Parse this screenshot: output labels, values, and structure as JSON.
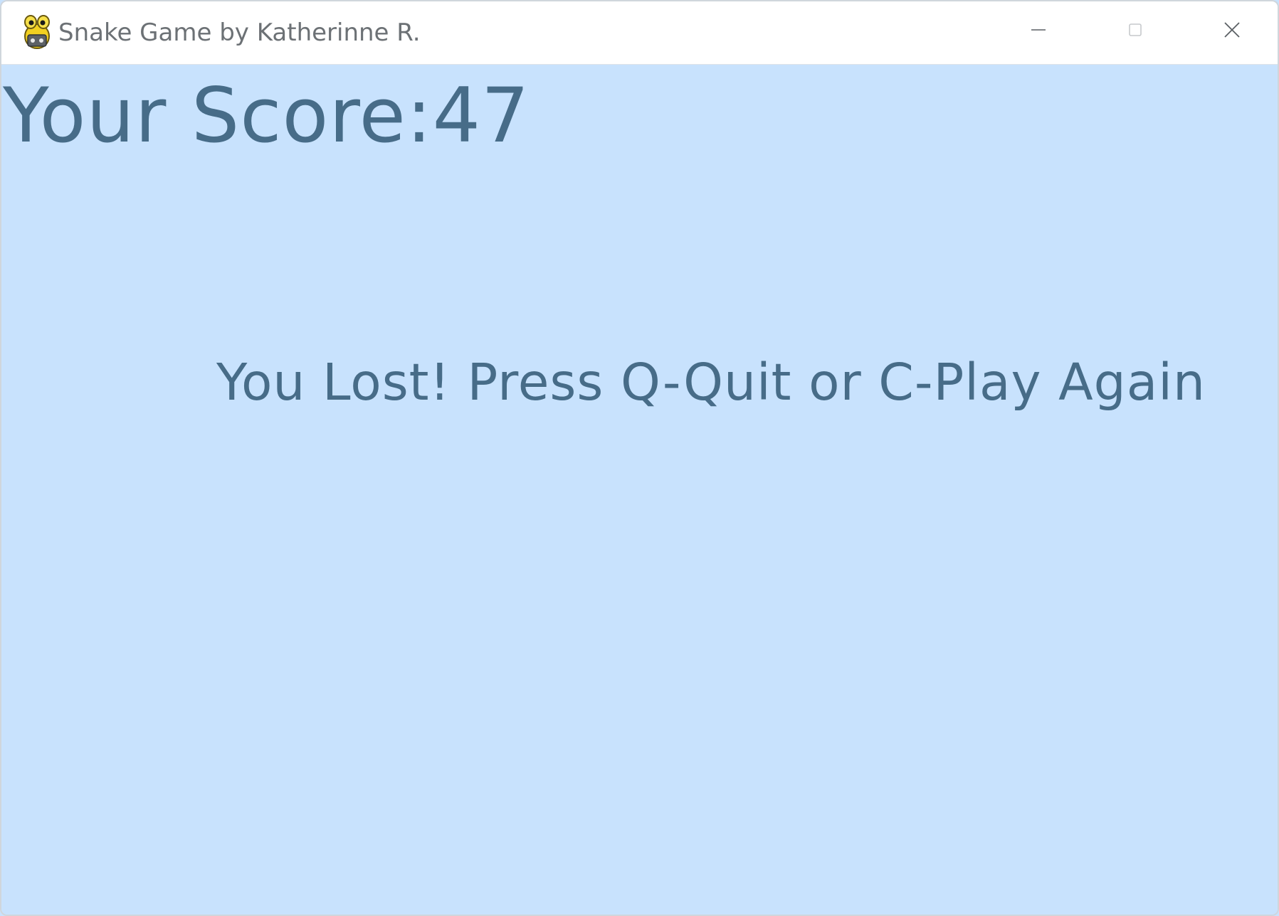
{
  "window": {
    "title": "Snake Game by Katherinne R.",
    "app_icon": "pygame-snake-icon",
    "controls": {
      "minimize_icon": "minimize-icon",
      "maximize_icon": "maximize-icon",
      "close_icon": "close-icon"
    }
  },
  "game": {
    "score_label": "Your Score:47",
    "message": "You Lost! Press Q-Quit or C-Play Again"
  },
  "colors": {
    "background": "#c8e2fd",
    "text": "#476c88",
    "titlebar": "#ffffff"
  }
}
